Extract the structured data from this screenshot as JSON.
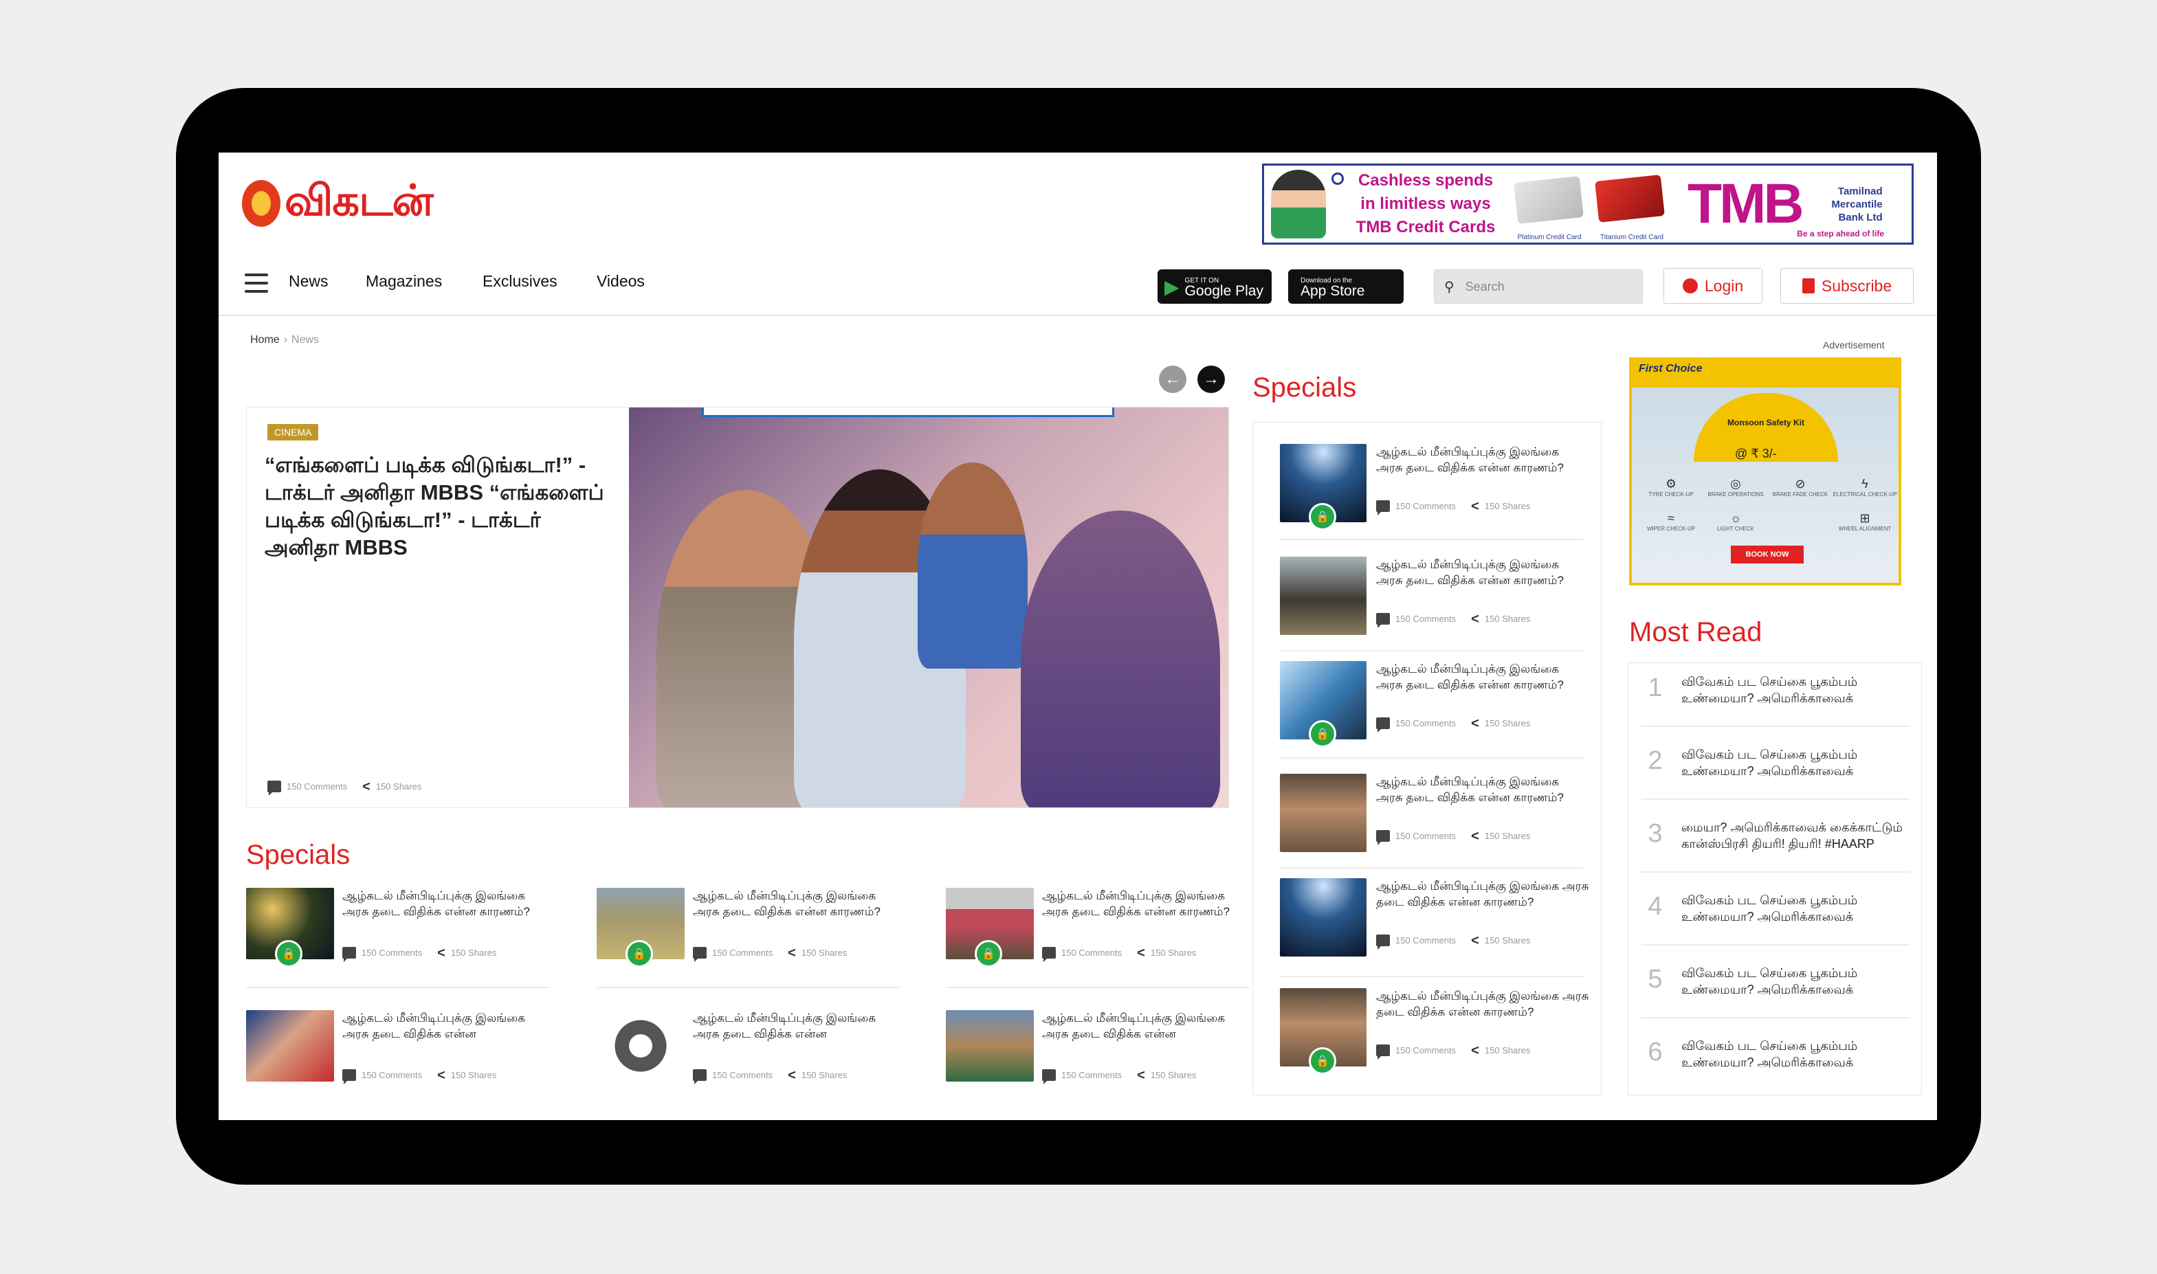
{
  "brand": {
    "logo_text": "விகடன்"
  },
  "top_ad": {
    "headline": "Cashless spends in limitless ways",
    "subline": "TMB Credit Cards",
    "card1": "Platinum Credit Card",
    "card2": "Titanium Credit Card",
    "logo": "TMB",
    "bank": "Tamilnad Mercantile Bank Ltd",
    "tagline": "Be a step ahead of life"
  },
  "nav": {
    "items": [
      "News",
      "Magazines",
      "Exclusives",
      "Videos"
    ]
  },
  "stores": {
    "google_small": "GET IT ON",
    "google": "Google Play",
    "apple_small": "Download on the",
    "apple": "App Store"
  },
  "search": {
    "placeholder": "Search"
  },
  "auth": {
    "login": "Login",
    "subscribe": "Subscribe"
  },
  "breadcrumb": {
    "home": "Home",
    "current": "News"
  },
  "hero": {
    "badge": "CINEMA",
    "title": "“எங்களைப் படிக்க விடுங்கடா!” - டாக்டர் அனிதா MBBS “எங்களைப் படிக்க விடுங்கடா!” - டாக்டர் அனிதா MBBS",
    "comments": "150 Comments",
    "shares": "150 Shares"
  },
  "specials_main": {
    "title": "Specials",
    "items": [
      {
        "text": "ஆழ்கடல் மீன்பிடிப்புக்கு இலங்கை அரசு தடை விதிக்க என்ன காரணம்?",
        "comments": "150 Comments",
        "shares": "150 Shares"
      },
      {
        "text": "ஆழ்கடல் மீன்பிடிப்புக்கு இலங்கை அரசு தடை விதிக்க என்ன காரணம்?",
        "comments": "150 Comments",
        "shares": "150 Shares"
      },
      {
        "text": "ஆழ்கடல் மீன்பிடிப்புக்கு இலங்கை அரசு தடை விதிக்க என்ன காரணம்?",
        "comments": "150 Comments",
        "shares": "150 Shares"
      },
      {
        "text": "ஆழ்கடல் மீன்பிடிப்புக்கு இலங்கை அரசு தடை விதிக்க என்ன",
        "comments": "150 Comments",
        "shares": "150 Shares"
      },
      {
        "text": "ஆழ்கடல் மீன்பிடிப்புக்கு இலங்கை அரசு தடை விதிக்க என்ன",
        "comments": "150 Comments",
        "shares": "150 Shares"
      },
      {
        "text": "ஆழ்கடல் மீன்பிடிப்புக்கு இலங்கை அரசு தடை விதிக்க என்ன",
        "comments": "150 Comments",
        "shares": "150 Shares"
      }
    ]
  },
  "specials_side": {
    "title": "Specials",
    "items": [
      {
        "text": "ஆழ்கடல் மீன்பிடிப்புக்கு இலங்கை அரசு தடை விதிக்க என்ன காரணம்?",
        "comments": "150 Comments",
        "shares": "150 Shares"
      },
      {
        "text": "ஆழ்கடல் மீன்பிடிப்புக்கு இலங்கை அரசு தடை விதிக்க என்ன காரணம்?",
        "comments": "150 Comments",
        "shares": "150 Shares"
      },
      {
        "text": "ஆழ்கடல் மீன்பிடிப்புக்கு இலங்கை அரசு தடை விதிக்க என்ன காரணம்?",
        "comments": "150 Comments",
        "shares": "150 Shares"
      },
      {
        "text": "ஆழ்கடல் மீன்பிடிப்புக்கு இலங்கை அரசு தடை விதிக்க என்ன காரணம்?",
        "comments": "150 Comments",
        "shares": "150 Shares"
      },
      {
        "text": "ஆழ்கடல் மீன்பிடிப்புக்கு இலங்கை அரசு தடை விதிக்க என்ன காரணம்?",
        "comments": "150 Comments",
        "shares": "150 Shares"
      },
      {
        "text": "ஆழ்கடல் மீன்பிடிப்புக்கு இலங்கை அரசு தடை விதிக்க என்ன காரணம்?",
        "comments": "150 Comments",
        "shares": "150 Shares"
      }
    ]
  },
  "advert": {
    "label": "Advertisement",
    "brand": "First Choice",
    "kit": "Monsoon Safety Kit",
    "price": "@ ₹ 3/-",
    "services": [
      "TYRE CHECK-UP",
      "BRAKE OPERATIONS",
      "BRAKE FADE CHECK",
      "ELECTRICAL CHECK-UP",
      "WIPER CHECK-UP",
      "LIGHT CHECK",
      "",
      "WHEEL ALIGNMENT"
    ],
    "cta": "BOOK NOW"
  },
  "most_read": {
    "title": "Most Read",
    "items": [
      {
        "num": "1",
        "text": "விவேகம் பட செய்கை பூகம்பம் உண்மையா? அமெரிக்காவைக்"
      },
      {
        "num": "2",
        "text": "விவேகம் பட செய்கை பூகம்பம் உண்மையா? அமெரிக்காவைக்"
      },
      {
        "num": "3",
        "text": "மையா? அமெரிக்காவைக் கைக்காட்டும் கான்ஸ்பிரசி தியரி! தியரி! #HAARP"
      },
      {
        "num": "4",
        "text": "விவேகம் பட செய்கை பூகம்பம் உண்மையா? அமெரிக்காவைக்"
      },
      {
        "num": "5",
        "text": "விவேகம் பட செய்கை பூகம்பம் உண்மையா? அமெரிக்காவைக்"
      },
      {
        "num": "6",
        "text": "விவேகம் பட செய்கை பூகம்பம் உண்மையா? அமெரிக்காவைக்"
      }
    ]
  },
  "colors": {
    "accent": "#e02222",
    "lock": "#23a845",
    "badge": "#c2972a"
  }
}
